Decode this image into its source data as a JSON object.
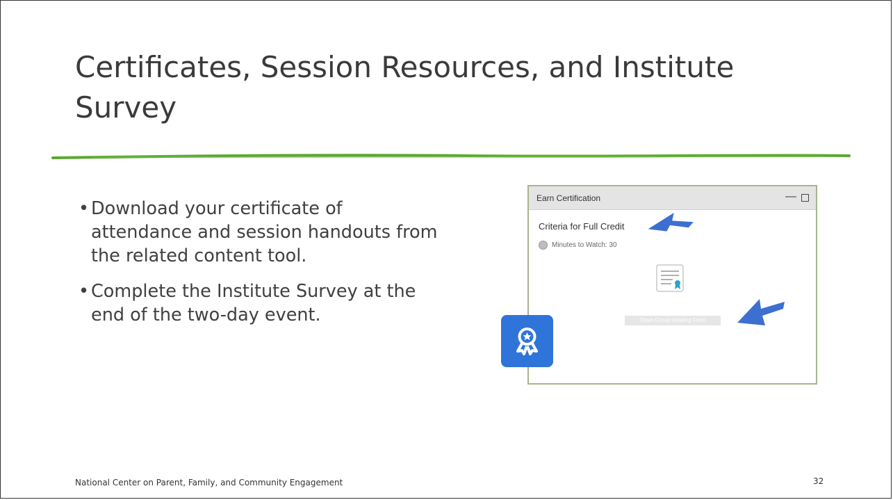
{
  "slide": {
    "title": "Certificates, Session Resources, and Institute Survey",
    "bullets": [
      "Download your certificate of attendance and session handouts from the related content tool.",
      "Complete the Institute Survey at the end of the two-day event."
    ],
    "footer": "National Center on Parent, Family, and Community Engagement",
    "page_number": "32",
    "accent_color": "#5aa832",
    "badge_color": "#2f74d9",
    "arrow_color": "#3d6fd0"
  },
  "screenshot": {
    "window_title": "Earn Certification",
    "minimize_icon": "minimize-icon",
    "maximize_icon": "maximize-icon",
    "criteria_heading": "Criteria for Full Credit",
    "minutes_label": "Minutes to Watch: 30",
    "button_label": "Open Group Viewing Form",
    "certificate_icon": "certificate-document-icon"
  }
}
